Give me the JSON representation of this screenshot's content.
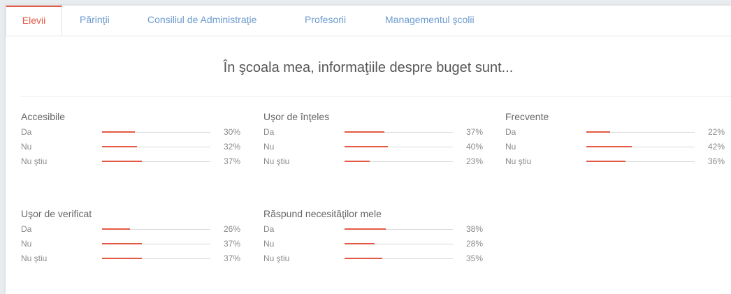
{
  "tabs": [
    {
      "label": "Elevii",
      "active": true
    },
    {
      "label": "Părinţii",
      "active": false
    },
    {
      "label": "Consiliul de Administraţie",
      "active": false
    },
    {
      "label": "Profesorii",
      "active": false
    },
    {
      "label": "Managementul şcolii",
      "active": false
    }
  ],
  "title": "În şcoala mea, informaţiile despre buget sunt...",
  "groups": [
    {
      "title": "Accesibile",
      "rows": [
        {
          "label": "Da",
          "value": 30,
          "pct": "30%"
        },
        {
          "label": "Nu",
          "value": 32,
          "pct": "32%"
        },
        {
          "label": "Nu ştiu",
          "value": 37,
          "pct": "37%"
        }
      ]
    },
    {
      "title": "Uşor de înţeles",
      "rows": [
        {
          "label": "Da",
          "value": 37,
          "pct": "37%"
        },
        {
          "label": "Nu",
          "value": 40,
          "pct": "40%"
        },
        {
          "label": "Nu ştiu",
          "value": 23,
          "pct": "23%"
        }
      ]
    },
    {
      "title": "Frecvente",
      "rows": [
        {
          "label": "Da",
          "value": 22,
          "pct": "22%"
        },
        {
          "label": "Nu",
          "value": 42,
          "pct": "42%"
        },
        {
          "label": "Nu ştiu",
          "value": 36,
          "pct": "36%"
        }
      ]
    },
    {
      "title": "Uşor de verificat",
      "rows": [
        {
          "label": "Da",
          "value": 26,
          "pct": "26%"
        },
        {
          "label": "Nu",
          "value": 37,
          "pct": "37%"
        },
        {
          "label": "Nu ştiu",
          "value": 37,
          "pct": "37%"
        }
      ]
    },
    {
      "title": "Răspund necesităţilor mele",
      "rows": [
        {
          "label": "Da",
          "value": 38,
          "pct": "38%"
        },
        {
          "label": "Nu",
          "value": 28,
          "pct": "28%"
        },
        {
          "label": "Nu ştiu",
          "value": 35,
          "pct": "35%"
        }
      ]
    }
  ],
  "colors": {
    "accent": "#e25a45",
    "link": "#6d9bd0",
    "track": "#d9d9d9"
  }
}
